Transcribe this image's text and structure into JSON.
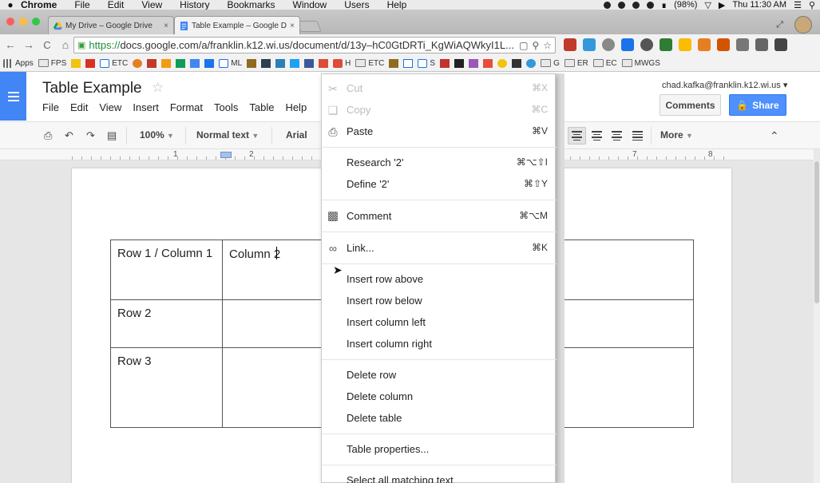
{
  "mac_menu": {
    "app_name": "Chrome",
    "items": [
      "File",
      "Edit",
      "View",
      "History",
      "Bookmarks",
      "Window",
      "Users",
      "Help"
    ],
    "battery": "(98%)",
    "clock": "Thu 11:30 AM"
  },
  "tabs": [
    {
      "label": "My Drive – Google Drive",
      "icon": "drive-icon",
      "close": "×"
    },
    {
      "label": "Table Example – Google D",
      "icon": "docs-icon",
      "close": "×"
    }
  ],
  "address_bar": {
    "scheme": "https://",
    "url": "docs.google.com/a/franklin.k12.wi.us/document/d/13y–hC0GtDRTi_KgWiAQWkyI1L..."
  },
  "bookmarks": [
    {
      "label": "Apps",
      "icon": "apps-grid-icon"
    },
    {
      "label": "FPS",
      "icon": "folder-icon"
    },
    {
      "label": "ETC",
      "icon": "calendar-icon"
    },
    {
      "label": "ML",
      "icon": "calendar-icon"
    },
    {
      "label": "H",
      "icon": "google-plus-icon"
    },
    {
      "label": "ETC",
      "icon": "folder-icon"
    },
    {
      "label": "S",
      "icon": "calendar-icon"
    },
    {
      "label": "G",
      "icon": "folder-icon"
    },
    {
      "label": "ER",
      "icon": "folder-icon"
    },
    {
      "label": "EC",
      "icon": "folder-icon"
    },
    {
      "label": "MWGS",
      "icon": "folder-icon"
    }
  ],
  "doc": {
    "title": "Table Example",
    "menu": [
      "File",
      "Edit",
      "View",
      "Insert",
      "Format",
      "Tools",
      "Table",
      "Help"
    ],
    "user_email": "chad.kafka@franklin.k12.wi.us",
    "comments_label": "Comments",
    "share_label": "Share"
  },
  "toolbar": {
    "zoom": "100%",
    "style": "Normal text",
    "font": "Arial",
    "more": "More"
  },
  "ruler": {
    "marks": [
      "1",
      "2",
      "7",
      "8"
    ]
  },
  "table": {
    "rows": [
      [
        "Row 1 / Column 1",
        "Column 2",
        ""
      ],
      [
        "Row 2",
        "",
        ""
      ],
      [
        "Row 3",
        "",
        ""
      ]
    ]
  },
  "context_menu": {
    "items": [
      {
        "label": "Cut",
        "shortcut": "⌘X",
        "icon": "scissors-icon",
        "disabled": true
      },
      {
        "label": "Copy",
        "shortcut": "⌘C",
        "icon": "copy-icon",
        "disabled": true
      },
      {
        "label": "Paste",
        "shortcut": "⌘V",
        "icon": "paste-icon",
        "disabled": false
      },
      {
        "label": "Research '2'",
        "shortcut": "⌘⌥⇧I",
        "disabled": false
      },
      {
        "label": "Define '2'",
        "shortcut": "⌘⇧Y",
        "disabled": false
      },
      {
        "label": "Comment",
        "shortcut": "⌘⌥M",
        "icon": "comment-icon",
        "disabled": false
      },
      {
        "label": "Link...",
        "shortcut": "⌘K",
        "icon": "link-icon",
        "disabled": false
      },
      {
        "label": "Insert row above",
        "shortcut": "",
        "disabled": false
      },
      {
        "label": "Insert row below",
        "shortcut": "",
        "disabled": false
      },
      {
        "label": "Insert column left",
        "shortcut": "",
        "disabled": false
      },
      {
        "label": "Insert column right",
        "shortcut": "",
        "disabled": false
      },
      {
        "label": "Delete row",
        "shortcut": "",
        "disabled": false
      },
      {
        "label": "Delete column",
        "shortcut": "",
        "disabled": false
      },
      {
        "label": "Delete table",
        "shortcut": "",
        "disabled": false
      },
      {
        "label": "Table properties...",
        "shortcut": "",
        "disabled": false
      },
      {
        "label": "Select all matching text",
        "shortcut": "",
        "disabled": false
      }
    ]
  }
}
